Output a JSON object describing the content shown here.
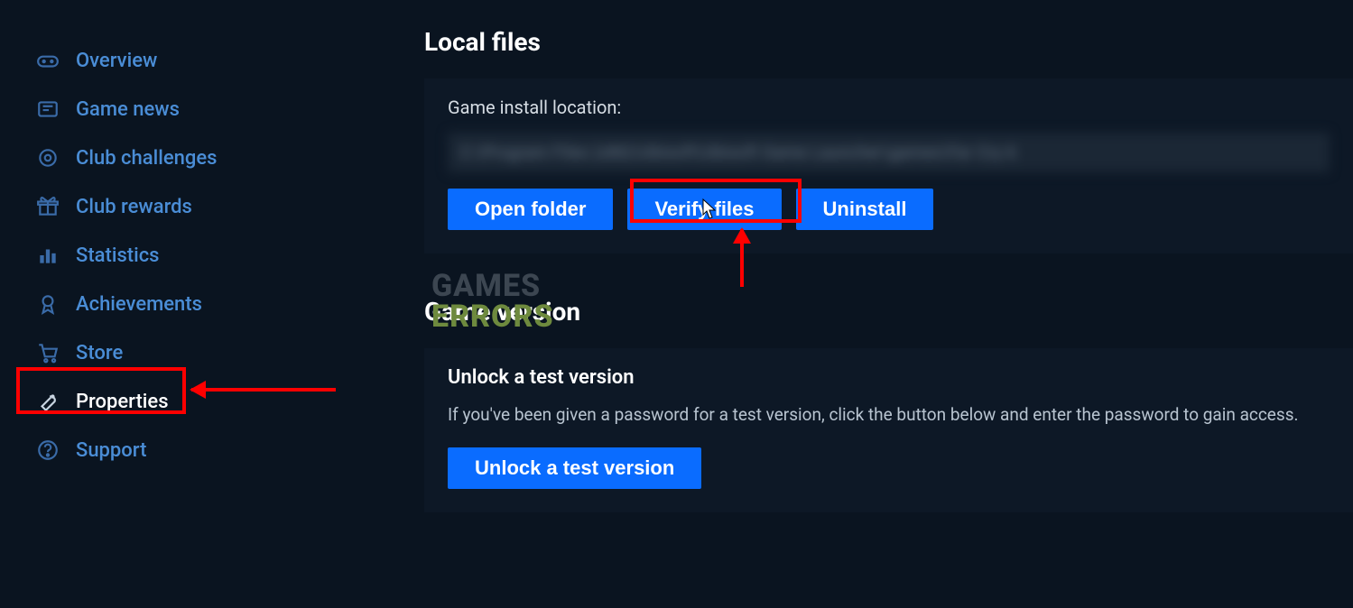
{
  "sidebar": {
    "items": [
      {
        "label": "Overview"
      },
      {
        "label": "Game news"
      },
      {
        "label": "Club challenges"
      },
      {
        "label": "Club rewards"
      },
      {
        "label": "Statistics"
      },
      {
        "label": "Achievements"
      },
      {
        "label": "Store"
      },
      {
        "label": "Properties"
      },
      {
        "label": "Support"
      }
    ]
  },
  "local_files": {
    "heading": "Local files",
    "install_label": "Game install location:",
    "install_path": "C:\\Program Files (x86)\\Ubisoft\\Ubisoft Game Launcher\\games\\Far Cry 6",
    "open_folder": "Open folder",
    "verify_files": "Verify files",
    "uninstall": "Uninstall"
  },
  "game_version": {
    "heading": "Game version",
    "unlock_title": "Unlock a test version",
    "unlock_desc": "If you've been given a password for a test version, click the button below and enter the password to gain access.",
    "unlock_button": "Unlock a test version"
  },
  "watermark": {
    "line1": "GAMES",
    "line2": "ERRORS"
  }
}
